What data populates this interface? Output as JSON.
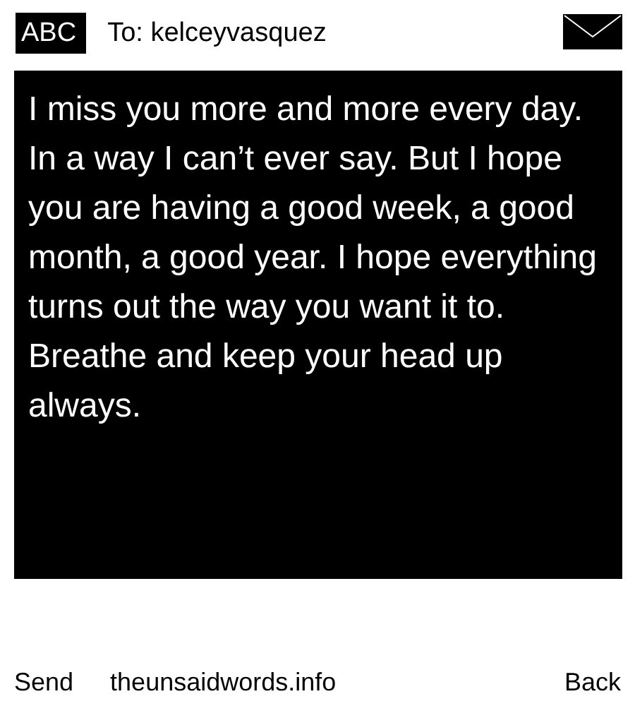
{
  "header": {
    "mode": "ABC",
    "recipient": "To: kelceyvasquez"
  },
  "message": "I miss you more and more every day. In a way I can’t ever say. But I hope you are having a good week, a good month, a good year. I hope everything turns out the way you want it to. Breathe and keep your head up always.",
  "footer": {
    "left": "Send",
    "center": "theunsaidwords.info",
    "right": "Back"
  }
}
